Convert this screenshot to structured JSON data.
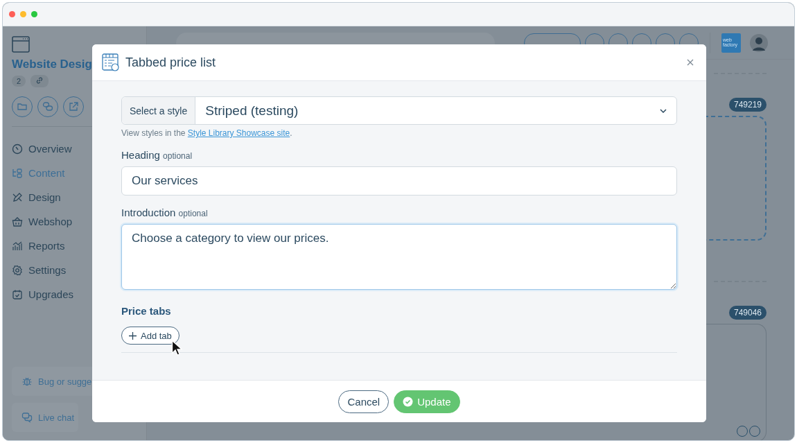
{
  "sidebar": {
    "title": "Website Desig",
    "count": "2",
    "nav": [
      {
        "label": "Overview",
        "selected": false
      },
      {
        "label": "Content",
        "selected": true
      },
      {
        "label": "Design",
        "selected": false
      },
      {
        "label": "Webshop",
        "selected": false
      },
      {
        "label": "Reports",
        "selected": false
      },
      {
        "label": "Settings",
        "selected": false
      },
      {
        "label": "Upgrades",
        "selected": false
      }
    ],
    "footer_buttons": [
      {
        "label": "Bug or sugge"
      },
      {
        "label": "Live chat"
      }
    ]
  },
  "topbar": {
    "logo_text": "web factory"
  },
  "canvas": {
    "blocks": [
      {
        "badge": "749219",
        "kind": "dashed"
      },
      {
        "badge": "749046",
        "kind": "solid"
      }
    ]
  },
  "dialog": {
    "title": "Tabbed price list",
    "style_select": {
      "label": "Select a style",
      "value": "Striped (testing)"
    },
    "hint": {
      "text": "View styles in the ",
      "link": "Style Library Showcase site",
      "end": "."
    },
    "fields": [
      {
        "label": "Heading",
        "note": "optional",
        "kind": "input",
        "value": "Our services",
        "focused": false
      },
      {
        "label": "Introduction",
        "note": "optional",
        "kind": "textarea",
        "value": "Choose a category to view our prices.",
        "focused": true
      }
    ],
    "section_title": "Price tabs",
    "add_button": "Add tab",
    "buttons": [
      {
        "label": "Cancel",
        "kind": "secondary"
      },
      {
        "label": "Update",
        "kind": "primary"
      }
    ]
  }
}
